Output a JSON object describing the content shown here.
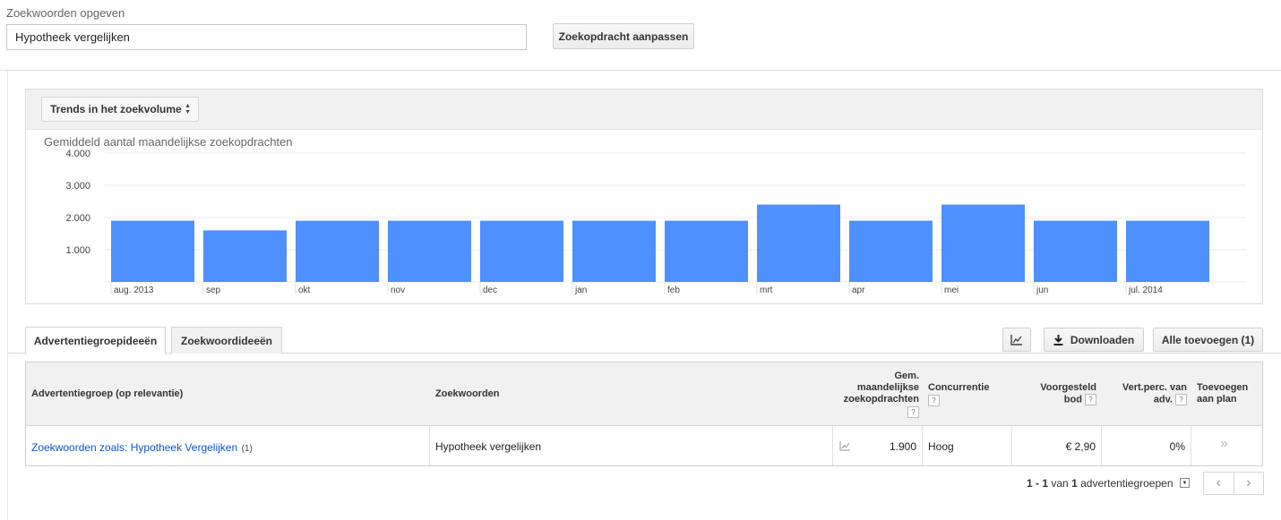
{
  "search": {
    "label": "Zoekwoorden opgeven",
    "value": "Hypotheek vergelijken",
    "modify_button": "Zoekopdracht aanpassen"
  },
  "chart_panel": {
    "selector_label": "Trends in het zoekvolume",
    "title": "Gemiddeld aantal maandelijkse zoekopdrachten"
  },
  "chart_data": {
    "type": "bar",
    "title": "Gemiddeld aantal maandelijkse zoekopdrachten",
    "categories": [
      "aug. 2013",
      "sep",
      "okt",
      "nov",
      "dec",
      "jan",
      "feb",
      "mrt",
      "apr",
      "mei",
      "jun",
      "jul. 2014"
    ],
    "values": [
      1900,
      1600,
      1900,
      1900,
      1900,
      1900,
      1900,
      2400,
      1900,
      2400,
      1900,
      1900
    ],
    "ylim": [
      0,
      4000
    ],
    "yticks": [
      1000,
      2000,
      3000,
      4000
    ],
    "ytick_labels": [
      "1.000",
      "2.000",
      "3.000",
      "4.000"
    ],
    "grid": true,
    "bar_color": "#4d90fe"
  },
  "tabs": [
    {
      "label": "Advertentiegroepideeën",
      "active": true
    },
    {
      "label": "Zoekwoordideeën",
      "active": false
    }
  ],
  "toolbar": {
    "chart_icon": "line-chart-icon",
    "download_label": "Downloaden",
    "add_all_label": "Alle toevoegen (1)"
  },
  "table": {
    "headers": {
      "adgroup": "Advertentiegroep (op relevantie)",
      "keywords": "Zoekwoorden",
      "searches_l1": "Gem.",
      "searches_l2": "maandelijkse",
      "searches_l3": "zoekopdrachten",
      "competition": "Concurrentie",
      "bid_l1": "Voorgesteld",
      "bid_l2": "bod",
      "share_l1": "Vert.perc. van",
      "share_l2": "adv.",
      "add_l1": "Toevoegen",
      "add_l2": "aan plan",
      "help": "?"
    },
    "rows": [
      {
        "adgroup": "Zoekwoorden zoals: Hypotheek Vergelijken",
        "adgroup_count": "(1)",
        "keywords": "Hypotheek vergelijken",
        "searches": "1.900",
        "competition": "Hoog",
        "bid": "€ 2,90",
        "share": "0%",
        "add": "»"
      }
    ]
  },
  "pager": {
    "range": "1 - 1",
    "of": "van",
    "total": "1",
    "unit": "advertentiegroepen",
    "prev": "‹",
    "next": "›"
  }
}
